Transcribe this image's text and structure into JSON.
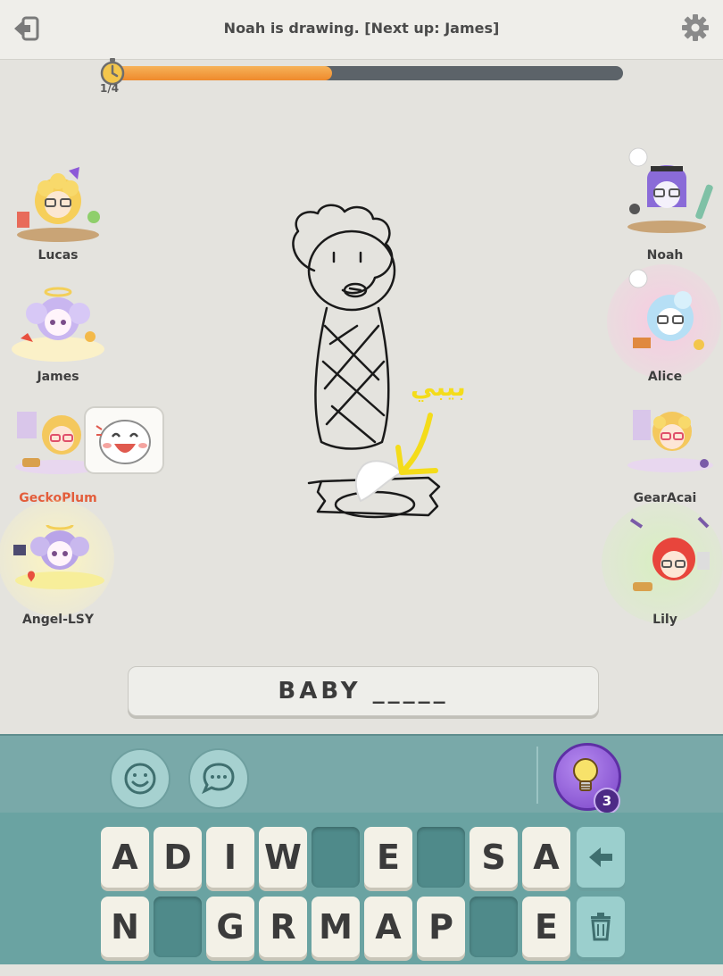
{
  "header": {
    "status_text": "Noah is drawing. [Next up: James]",
    "round_label": "1/4",
    "timer_progress": 0.43
  },
  "players": {
    "left": [
      "Lucas",
      "James",
      "GeckoPlum",
      "Angel-LSY"
    ],
    "right": [
      "Noah",
      "Alice",
      "GearAcai",
      "Lily"
    ]
  },
  "canvas": {
    "annotation_text": "بيبي"
  },
  "hint": {
    "text": "BABY _____"
  },
  "toolbar": {
    "hint_count": "3"
  },
  "keyboard": {
    "row1": [
      "A",
      "D",
      "I",
      "W",
      "",
      "E",
      "",
      "S",
      "A"
    ],
    "row2": [
      "N",
      "",
      "G",
      "R",
      "M",
      "A",
      "P",
      "",
      "E"
    ]
  },
  "colors": {
    "accent_teal": "#6aa3a2",
    "timer_orange": "#ef8a2c",
    "hint_purple": "#7b45c8"
  },
  "icons": {
    "back": "exit-arrow-icon",
    "settings": "gear-icon",
    "timer": "stopwatch-icon",
    "emoji": "smiley-icon",
    "chat": "speech-bubble-icon",
    "hint": "lightbulb-icon",
    "backspace": "left-arrow-icon",
    "clear": "trash-icon"
  }
}
